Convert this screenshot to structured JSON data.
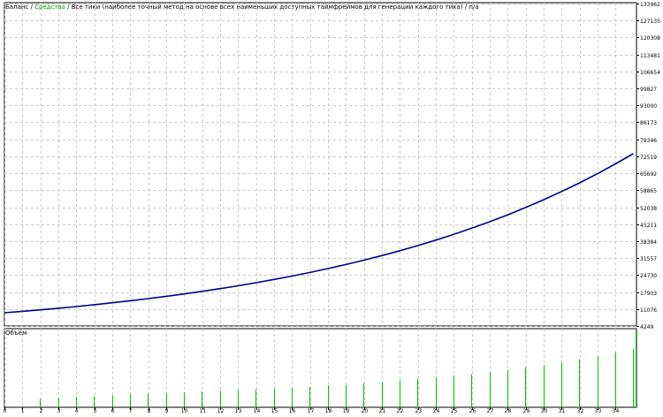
{
  "header": {
    "balance_label": "Баланс",
    "sep1": " / ",
    "equity_label": "Средства",
    "sep2": " / ",
    "description": "Все тики (наиболее точный метод на основе всех наименьших доступных таймфреймов для генерации каждого тика)",
    "sep3": " / ",
    "suffix": "п/а"
  },
  "colors": {
    "background": "#ffffff",
    "grid": "#c8c8c8",
    "frame": "#000000",
    "balance_line": "#00008b",
    "volume_bars": "#00c000",
    "balance_label": "#000000",
    "equity_label": "#00a000"
  },
  "volume_panel": {
    "label": "Объём"
  },
  "chart_data": [
    {
      "type": "line",
      "title": "",
      "series": [
        {
          "name": "Баланс",
          "x": [
            0,
            1,
            2,
            3,
            4,
            5,
            6,
            7,
            8,
            9,
            10,
            11,
            12,
            13,
            14,
            15,
            16,
            17,
            18,
            19,
            20,
            21,
            22,
            23,
            24,
            25,
            26,
            27,
            28,
            29,
            30,
            31,
            32,
            33,
            34,
            35
          ],
          "values": [
            9570,
            10140,
            10750,
            11400,
            12080,
            12810,
            13580,
            14400,
            15260,
            16180,
            17150,
            18180,
            19270,
            20430,
            21650,
            22960,
            24330,
            25790,
            27340,
            28980,
            30720,
            32560,
            34520,
            36590,
            38780,
            41110,
            43580,
            46190,
            48960,
            51900,
            55020,
            58320,
            61820,
            65530,
            69460,
            73630
          ]
        }
      ],
      "yticks": [
        4249,
        11076,
        17903,
        24730,
        31557,
        38384,
        45211,
        52038,
        58865,
        65692,
        72519,
        79346,
        86173,
        93000,
        99827,
        106654,
        113481,
        120308,
        127135,
        133962
      ],
      "ylim": [
        4249,
        133962
      ],
      "xlim": [
        0,
        35
      ],
      "grid": true
    },
    {
      "type": "bar",
      "title": "",
      "categories": [
        "0",
        "1",
        "2",
        "3",
        "4",
        "5",
        "6",
        "7",
        "8",
        "9",
        "10",
        "11",
        "12",
        "13",
        "14",
        "15",
        "16",
        "17",
        "18",
        "19",
        "20",
        "21",
        "22",
        "23",
        "24",
        "25",
        "26",
        "27",
        "28",
        "29",
        "30",
        "31",
        "32",
        "33",
        "34"
      ],
      "values": [
        0,
        0.11,
        0.13,
        0.14,
        0.15,
        0.16,
        0.17,
        0.18,
        0.19,
        0.2,
        0.21,
        0.22,
        0.23,
        0.24,
        0.25,
        0.26,
        0.27,
        0.29,
        0.3,
        0.32,
        0.34,
        0.36,
        0.38,
        0.4,
        0.42,
        0.44,
        0.47,
        0.5,
        0.53,
        0.56,
        0.6,
        0.64,
        0.68,
        0.73,
        0.78
      ],
      "last_value": 1.0,
      "grid": true
    }
  ]
}
